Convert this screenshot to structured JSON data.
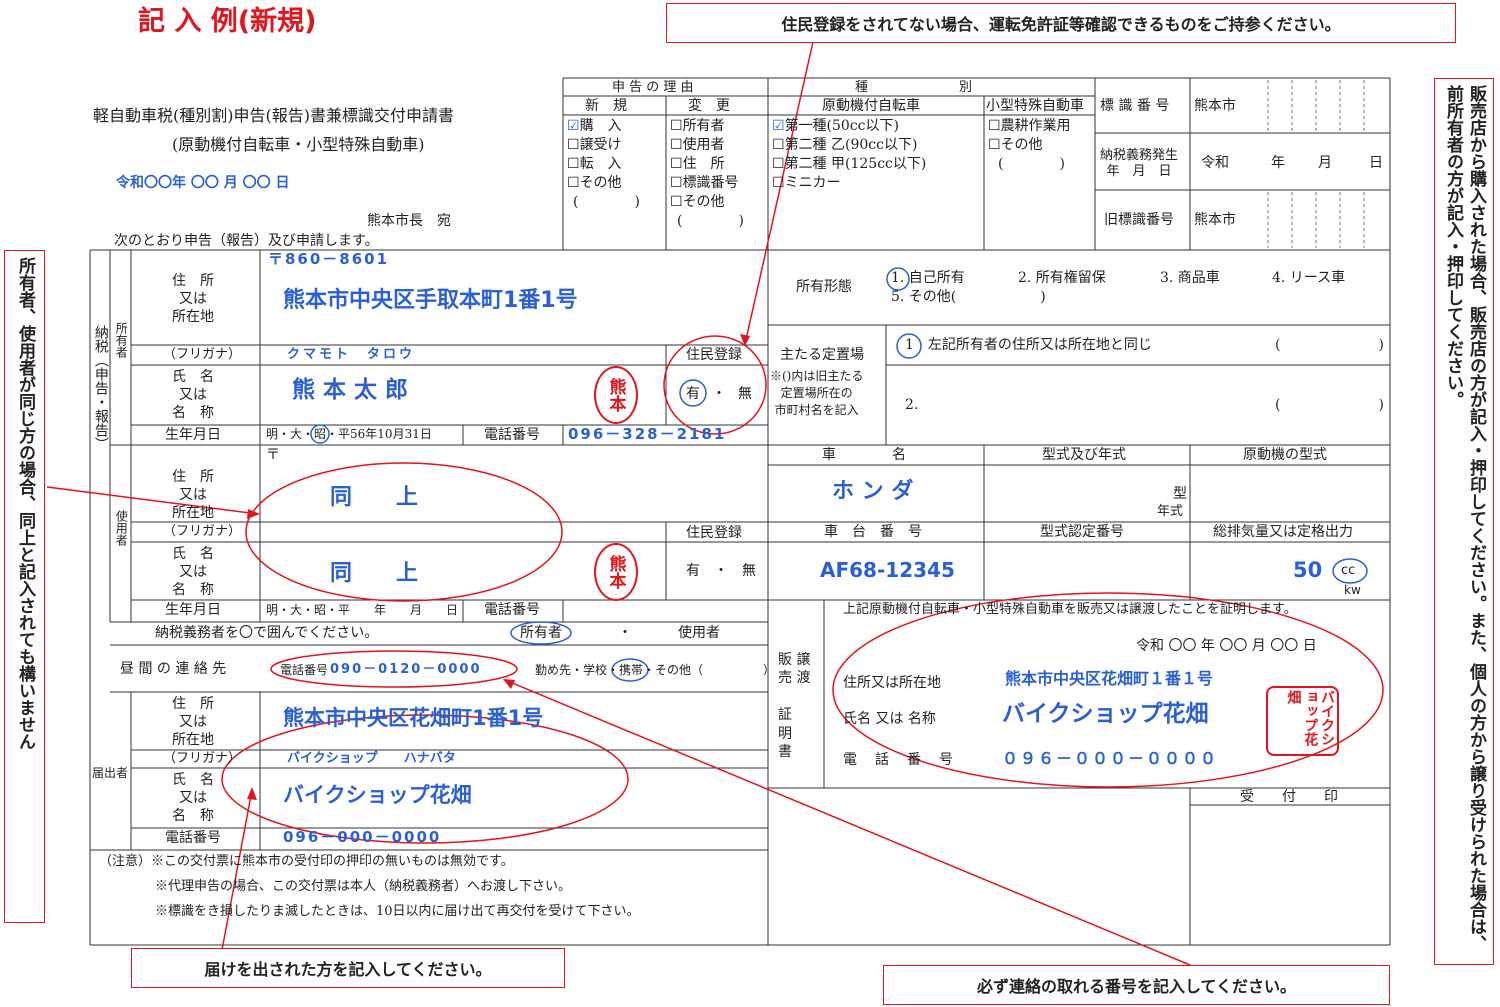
{
  "heading": "記 入 例(新規)",
  "form": {
    "title": "軽自動車税(種別割)申告(報告)書兼標識交付申請書",
    "subtitle": "(原動機付自転車・小型特殊自動車)",
    "date": "令和〇〇年 〇〇 月 〇〇 日",
    "addressee": "熊本市長　宛",
    "intro": "次のとおり申告（報告）及び申請します。"
  },
  "reason": {
    "header": "申 告 の 理 由",
    "new_header": "新　規",
    "change_header": "変　更",
    "new_items": [
      "購　入",
      "譲受け",
      "転　入",
      "その他"
    ],
    "new_checked": "☑",
    "unchecked": "☐",
    "paren": "(　　　　)",
    "change_items": [
      "所有者",
      "使用者",
      "住　所",
      "標識番号",
      "その他"
    ]
  },
  "category": {
    "header": "種　　　　　　　別",
    "moped_header": "原動機付自転車",
    "special_header": "小型特殊自動車",
    "moped_items": [
      "第一種(50cc以下)",
      "第二種 乙(90cc以下)",
      "第二種 甲(125cc以下)",
      "ミニカー"
    ],
    "special_items": [
      "農耕作業用",
      "その他"
    ],
    "special_paren": "(　　　　)"
  },
  "plate": {
    "number_label": "標 識 番 号",
    "number_value": "熊本市",
    "tax_date_label": "納税義務発生\n年　月　日",
    "era": "令和",
    "year": "年",
    "month": "月",
    "day": "日",
    "old_label": "旧標識番号",
    "old_value": "熊本市"
  },
  "owner": {
    "side_label": "納税（申告・報告）",
    "section": "所有者",
    "address_label": "住　所\n又は\n所在地",
    "postal": "〒860－8601",
    "address": "熊本市中央区手取本町1番1号",
    "furigana_label": "（フリガナ）",
    "name_label": "氏　名\n又は\n名　称",
    "furigana": "クマモト　タロウ",
    "name": "熊 本 太 郎",
    "seal": "熊本",
    "resident_label": "住民登録",
    "resident_yes": "有",
    "resident_sep": "・",
    "resident_no": "無",
    "birth_label": "生年月日",
    "birth_eras": "明・大・",
    "birth_era_selected": "昭",
    "birth_value": "・平56年10月31日",
    "phone_label": "電話番号",
    "phone": "096－328－2181"
  },
  "user": {
    "section": "使用者",
    "postal_mark": "〒",
    "address": "同　　上",
    "name": "同　　上",
    "seal": "熊本",
    "resident": "有　・　無",
    "birth_blank": "明・大・昭・平　　年　　月　　日"
  },
  "taxpayer_note": {
    "label": "納税義務者を〇で囲んでください。",
    "owner": "所有者",
    "sep": "・",
    "user": "使用者"
  },
  "daytime": {
    "label": "昼 間 の 連 絡 先",
    "phone_prefix": "電話番号",
    "phone": "090－0120－0000",
    "place_prefix": "勤め先・学校・",
    "place_selected": "携帯",
    "place_suffix": "・その他（　　　　　）"
  },
  "filer": {
    "section": "届出者",
    "address": "熊本市中央区花畑町1番1号",
    "furigana": "バイクショップ　　ハナバタ",
    "name": "バイクショップ花畑",
    "phone": "096－000－0000"
  },
  "notes": [
    "（注意）※この交付票に熊本市の受付印の押印の無いものは無効です。",
    "※代理申告の場合、この交付票は本人（納税義務者）へお渡し下さい。",
    "※標識をき損したりま滅したときは、10日以内に届け出て再交付を受けて下さい。"
  ],
  "ownership": {
    "label": "所有形態",
    "options": [
      "1. 自己所有",
      "2. 所有権留保",
      "3. 商品車",
      "4. リース車"
    ],
    "other": "5. その他(　　　　　　)"
  },
  "storage": {
    "label": "主たる定置場",
    "note": "※()内は旧主たる\n定置場所在の\n市町村名を記入",
    "opt1": "1　左記所有者の住所又は所在地と同じ",
    "opt2": "2.",
    "paren": "(　　　　　　　)"
  },
  "vehicle": {
    "maker_label": "車　　　　名",
    "maker": "ホ ン ダ",
    "model_label": "型式及び年式",
    "model_suffix": "型",
    "year_suffix": "年式",
    "engine_label": "原動機の型式",
    "chassis_label": "車　台　番　号",
    "chassis": "AF68-12345",
    "approval_label": "型式認定番号",
    "displacement_label": "総排気量又は定格出力",
    "displacement": "50",
    "unit_cc": "cc",
    "unit_kw": "kw"
  },
  "sale": {
    "side_label": "販 譲\n売 渡\n\n証\n明\n書",
    "statement": "上記原動機付自転車・小型特殊自動車を販売又は譲渡したことを証明します。",
    "date": "令和 〇〇 年 〇〇 月 〇〇 日",
    "address_label": "住所又は所在地",
    "address": "熊本市中央区花畑町１番１号",
    "name_label": "氏名 又は 名称",
    "name": "バイクショップ花畑",
    "phone_label": "電　話　番　号",
    "phone": "０９６－０００－００００",
    "seal": "バイクショップ花畑"
  },
  "receipt_label": "受　　付　　印",
  "annotations": {
    "top": "住民登録をされてない場合、運転免許証等確認できるものをご持参ください。",
    "bottom_left": "届けを出された方を記入してください。",
    "bottom_right": "必ず連絡の取れる番号を記入してください。",
    "left": "所有者、使用者が同じ方の場合、同上と記入されても構いません",
    "right": "販売店から購入された場合、販売店の方が記入・押印してください。また、個人の方から譲り受けられた場合は、前所有者の方が記入・押印してください。"
  },
  "colors": {
    "annotation_red": "#e3141b",
    "fill_blue": "#2b5fd6"
  }
}
